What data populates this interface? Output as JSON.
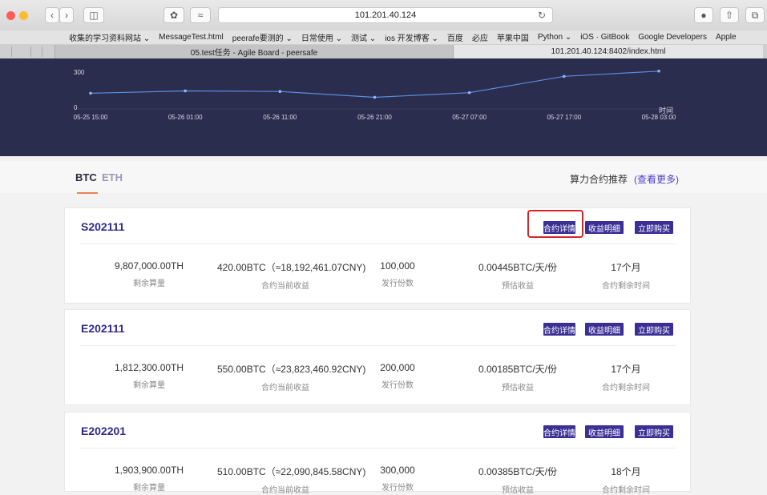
{
  "browser": {
    "url": "101.201.40.124",
    "bookmarks": [
      "收集的学习资料网站 ⌄",
      "MessageTest.html",
      "peerafe要测的 ⌄",
      "日常使用 ⌄",
      "测试 ⌄",
      "ios 开发博客 ⌄",
      "百度",
      "必应",
      "苹果中国",
      "Python ⌄",
      "iOS · GitBook",
      "Google Developers",
      "Apple"
    ],
    "tabs": [
      "05.test任务 - Agile Board - peersafe",
      "101.201.40.124:8402/index.html"
    ]
  },
  "chart_data": {
    "type": "line",
    "x": [
      "05-25 15:00",
      "05-26 01:00",
      "05-26 11:00",
      "05-26 21:00",
      "05-27 07:00",
      "05-27 17:00",
      "05-28 03:00"
    ],
    "values": [
      135,
      155,
      150,
      100,
      140,
      280,
      325
    ],
    "ylim": [
      0,
      380
    ],
    "yticks": [
      "300",
      "0"
    ],
    "xlabel": "时间",
    "grid": false,
    "colors": {
      "background": "#2a2d4d",
      "line": "#5b8de0"
    }
  },
  "coin_tabs": {
    "btc": "BTC",
    "eth": "ETH"
  },
  "recommend": {
    "label": "算力合约推荐",
    "more": "(查看更多)"
  },
  "buttons": {
    "detail": "合约详情",
    "income": "收益明细",
    "buy": "立即购买"
  },
  "labels": {
    "remaining": "剩余算量",
    "current_income": "合约当前收益",
    "issued": "发行份数",
    "estimated": "预估收益",
    "remaining_time": "合约剩余时间"
  },
  "contracts": [
    {
      "id": "S202111",
      "remaining": "9,807,000.00TH",
      "income": "420.00BTC（≈18,192,461.07CNY)",
      "issued": "100,000",
      "estimated": "0.00445BTC/天/份",
      "time": "17个月"
    },
    {
      "id": "E202111",
      "remaining": "1,812,300.00TH",
      "income": "550.00BTC（≈23,823,460.92CNY)",
      "issued": "200,000",
      "estimated": "0.00185BTC/天/份",
      "time": "17个月"
    },
    {
      "id": "E202201",
      "remaining": "1,903,900.00TH",
      "income": "510.00BTC（≈22,090,845.58CNY)",
      "issued": "300,000",
      "estimated": "0.00385BTC/天/份",
      "time": "18个月"
    }
  ]
}
